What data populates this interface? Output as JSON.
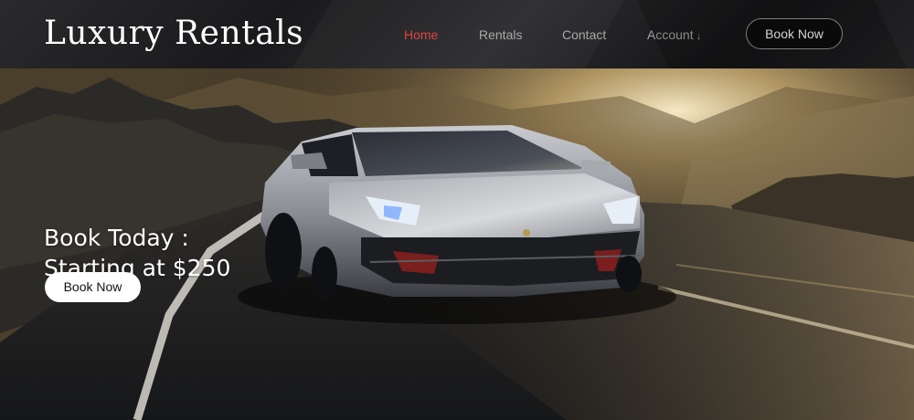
{
  "header": {
    "logo": "Luxury Rentals",
    "nav": {
      "home": "Home",
      "rentals": "Rentals",
      "contact": "Contact",
      "account": "Account",
      "account_arrow": "↓"
    },
    "book_label": "Book Now"
  },
  "hero": {
    "heading_line1": "Book Today :",
    "heading_line2": "Starting at $250",
    "book_label": "Book Now"
  },
  "colors": {
    "accent": "#e0443e",
    "nav_text": "#a8a8a8",
    "button_bg": "#ffffff"
  }
}
